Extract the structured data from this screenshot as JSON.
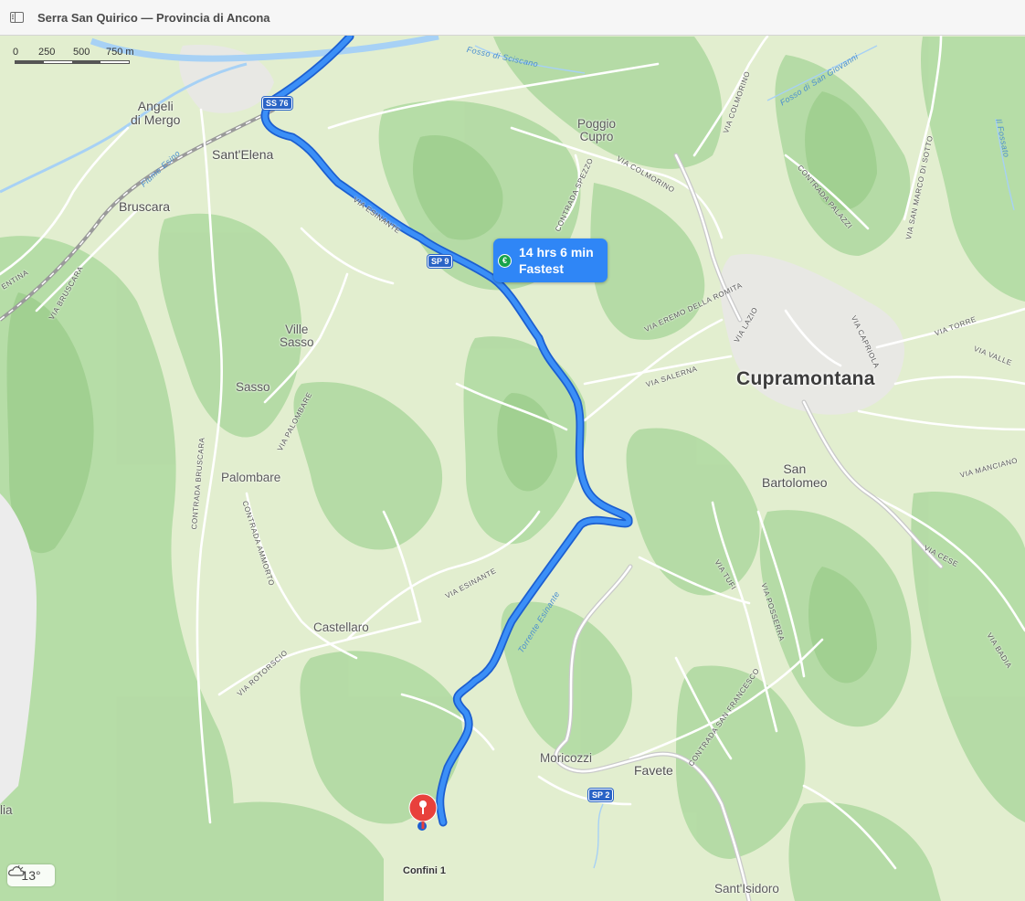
{
  "window": {
    "title": "Serra San Quirico — Provincia di Ancona"
  },
  "colors": {
    "route": "#2f86f6",
    "land": "#dfeccb",
    "forest": "#a9d59a",
    "pin": "#e8413c"
  },
  "scale": {
    "ticks": [
      "0",
      "250",
      "500",
      "750 m"
    ]
  },
  "route": {
    "time": "14 hrs 6 min",
    "type": "Fastest",
    "icon": "toll-euro-icon"
  },
  "destination": {
    "label": "Confini 1",
    "icon": "map-pin-icon"
  },
  "weather": {
    "temp": "13°",
    "icon": "cloud-icon"
  },
  "places": {
    "cupramontana": "Cupramontana",
    "angeli_1": "Angeli",
    "angeli_2": "di Mergo",
    "santelena": "Sant'Elena",
    "bruscara": "Bruscara",
    "poggio_1": "Poggio",
    "poggio_2": "Cupro",
    "ville_1": "Ville",
    "ville_2": "Sasso",
    "sasso": "Sasso",
    "palombare": "Palombare",
    "sanbart_1": "San",
    "sanbart_2": "Bartolomeo",
    "castellaro": "Castellaro",
    "moricozzi": "Moricozzi",
    "favete": "Favete",
    "santisidoro": "Sant'Isidoro",
    "lia": "lia"
  },
  "roads": {
    "via_esinante_1": "VIA ESINANTE",
    "via_esinante_2": "VIA ESINANTE",
    "via_colmorino_1": "VIA COLMORINO",
    "via_colmorino_2": "VIA COLMORINO",
    "contrada_spezzo": "CONTRADA SPEZZO",
    "contrada_palazzi": "CONTRADA PALAZZI",
    "via_san_marco": "VIA SAN MARCO DI SOTTO",
    "via_eremo": "VIA EREMO DELLA ROMITA",
    "via_lazio": "VIA LAZIO",
    "via_capriola": "VIA CAPRIOLA",
    "via_torre": "VIA TORRE",
    "via_valle": "VIA VALLE",
    "via_salerna": "VIA SALERNA",
    "via_manciano": "VIA MANCIANO",
    "via_cese": "VIA CESE",
    "via_tufi": "VIA TUFI",
    "via_posserra": "VIA POSSERRA",
    "via_badia": "VIA BADIA",
    "contrada_san_francesco": "CONTRADA SAN FRANCESCO",
    "via_bruscara": "VIA BRUSCARA",
    "contrada_bruscara": "CONTRADA BRUSCARA",
    "via_palombare": "VIA PALOMBARE",
    "contrada_ammorto": "CONTRADA AMMORTO",
    "via_rotorscio": "VIA ROTORSCIO",
    "ventina": "ENTINA"
  },
  "waterways": {
    "fosso_sciscano": "Fosso di Sciscano",
    "fosso_san_giovanni": "Fosso di San Giovanni",
    "il_fossato": "Il Fossato",
    "fiume_esino": "Fiume Esino",
    "torrente_esinante": "Torrente Esinante"
  },
  "shields": {
    "ss76": "SS 76",
    "sp9": "SP 9",
    "sp2": "SP 2"
  }
}
